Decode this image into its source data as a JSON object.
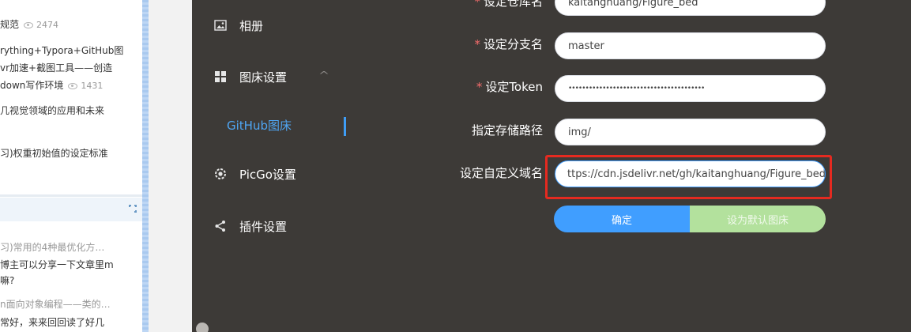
{
  "blog": {
    "articles": [
      {
        "line1": "规范",
        "views": "2474"
      },
      {
        "line1": "rything+Typora+GitHub图",
        "line2": "vr加速+截图工具——创造",
        "line3": "down写作环境",
        "views": "1431"
      },
      {
        "line1": "几视觉领域的应用和未来"
      },
      {
        "line1": "习)权重初始值的设定标准"
      }
    ],
    "comments": [
      {
        "title": "习)常用的4种最优化方…",
        "text1": "博主可以分享一下文章里m",
        "text2": "嘛?"
      },
      {
        "title": "n面向对象编程——类的…",
        "text1": "常好，来来回回读了好几"
      }
    ],
    "corner_icon": "expand-icon"
  },
  "sidebar": {
    "items": [
      {
        "label": "相册",
        "icon": "image-icon"
      },
      {
        "label": "图床设置",
        "icon": "grid-icon"
      },
      {
        "label": "PicGo设置",
        "icon": "gear-icon"
      },
      {
        "label": "插件设置",
        "icon": "share-icon"
      }
    ],
    "sub_item": "GitHub图床",
    "caret": "^"
  },
  "form": {
    "repo_label": "设定仓库名",
    "repo_value": "kaitanghuang/Figure_bed",
    "branch_label": "设定分支名",
    "branch_value": "master",
    "token_label": "设定Token",
    "token_value": "••••••••••••••••••••••••••••••••••••••••",
    "path_label": "指定存储路径",
    "path_value": "img/",
    "domain_label": "设定自定义域名",
    "domain_value": "ttps://cdn.jsdelivr.net/gh/kaitanghuang/Figure_bed",
    "confirm_label": "确定",
    "default_label": "设为默认图床"
  },
  "colors": {
    "primary": "#409eff",
    "highlight": "#e52a20",
    "default_btn": "#b3e19d",
    "app_bg": "#3d3a37"
  }
}
